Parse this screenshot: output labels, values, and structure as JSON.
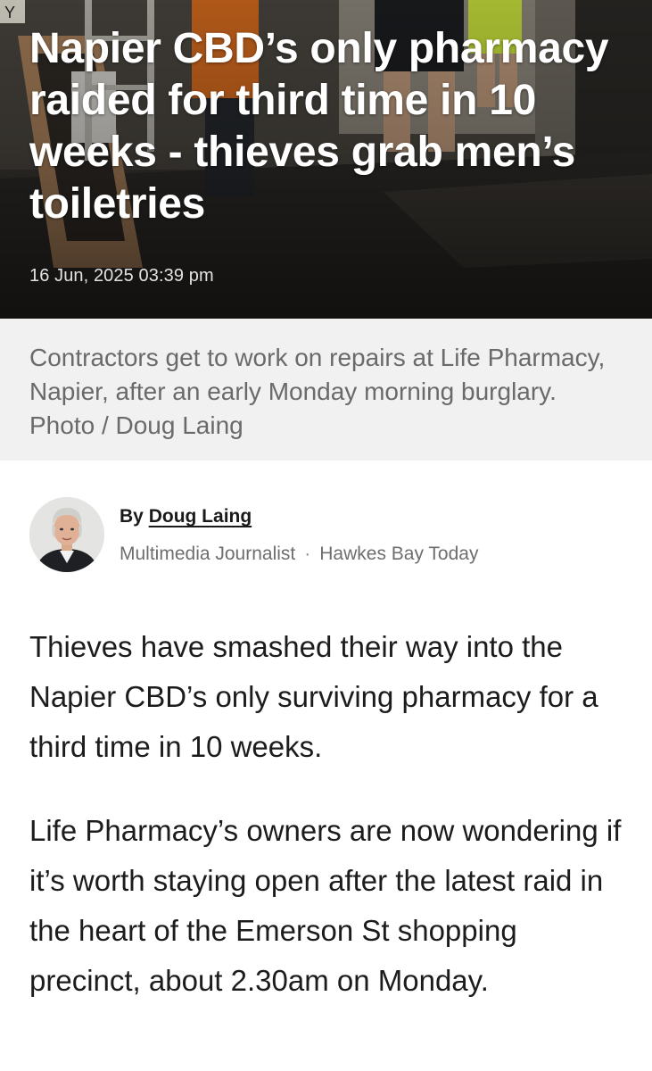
{
  "article": {
    "headline": "Napier CBD’s only pharmacy raided for third time in 10 weeks - thieves grab men’s toiletries",
    "date": "16 Jun, 2025 03:39 pm",
    "caption": "Contractors get to work on repairs at Life Pharmacy, Napier, after an early Monday morning burglary. Photo / Doug Laing",
    "byline": {
      "by_label": "By",
      "author": "Doug Laing",
      "role": "Multimedia Journalist",
      "separator": "·",
      "outlet": "Hawkes Bay Today"
    },
    "paragraphs": [
      "Thieves have smashed their way into the Napier CBD’s only surviving pharmacy for a third time in 10 weeks.",
      "Life Pharmacy’s owners are now wondering if it’s worth staying open after the latest raid in the heart of the Emerson St shopping precinct, about 2.30am on Monday."
    ]
  },
  "hero_sign_letter": "Y",
  "colors": {
    "caption_background": "#f1f1f1",
    "caption_text": "#6a6a6a",
    "headline_text": "#ffffff",
    "body_text": "#1c1c1c",
    "secondary_text": "#6e6e6e"
  }
}
